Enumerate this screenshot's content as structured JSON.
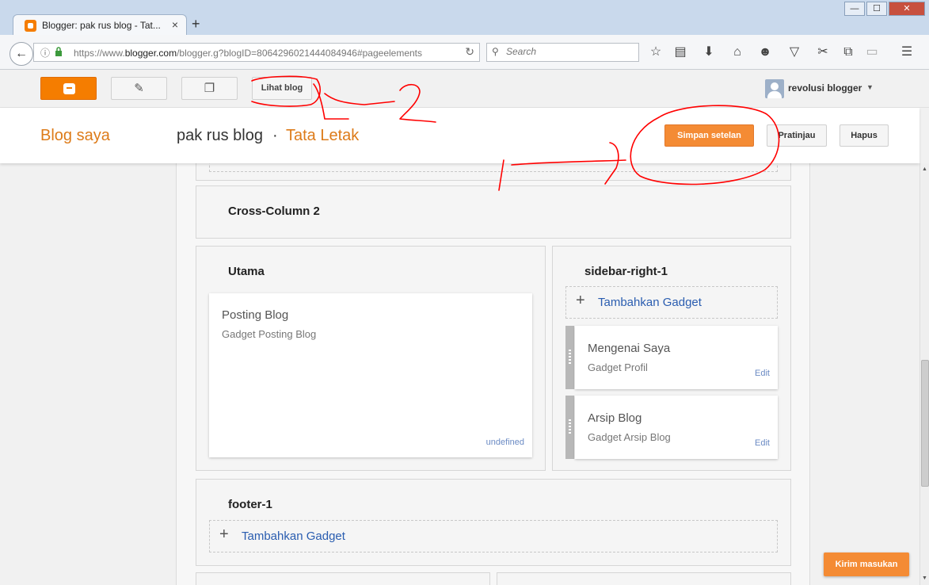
{
  "browser": {
    "tab_title": "Blogger: pak rus blog - Tat...",
    "tab_close": "×",
    "new_tab": "+",
    "url_prefix": "https://www.",
    "url_domain": "blogger.com",
    "url_path": "/blogger.g?blogID=8064296021444084946#pageelements",
    "search_placeholder": "Search",
    "window_minimize": "—",
    "window_maximize": "☐",
    "window_close": "✕",
    "toolbar_icons": [
      "bookmark-star-icon",
      "reading-list-icon",
      "download-icon",
      "home-icon",
      "emoji-icon",
      "pocket-icon",
      "screenshot-icon",
      "sync-icon",
      "extension-icon",
      "menu-icon"
    ]
  },
  "topbar": {
    "view_blog_label": "Lihat blog",
    "user_name": "revolusi blogger"
  },
  "subheader": {
    "blog_saya": "Blog saya",
    "blog_name": "pak rus blog",
    "separator": "·",
    "page_name": "Tata Letak",
    "save_label": "Simpan setelan",
    "preview_label": "Pratinjau",
    "delete_label": "Hapus"
  },
  "layout": {
    "cross_column_2": "Cross-Column 2",
    "main": {
      "title": "Utama",
      "gadget_title": "Posting Blog",
      "gadget_subtitle": "Gadget Posting Blog",
      "gadget_link": "undefined"
    },
    "sidebar": {
      "title": "sidebar-right-1",
      "add_gadget": "Tambahkan Gadget",
      "gadgets": [
        {
          "title": "Mengenai Saya",
          "subtitle": "Gadget Profil",
          "edit": "Edit"
        },
        {
          "title": "Arsip Blog",
          "subtitle": "Gadget Arsip Blog",
          "edit": "Edit"
        }
      ]
    },
    "footer": {
      "title": "footer-1",
      "add_gadget": "Tambahkan Gadget"
    }
  },
  "feedback_label": "Kirim masukan",
  "colors": {
    "accent_orange": "#f48b34",
    "brand_orange": "#f57d00",
    "link_blue": "#2a5db0",
    "annotation_red": "#ff0000"
  }
}
